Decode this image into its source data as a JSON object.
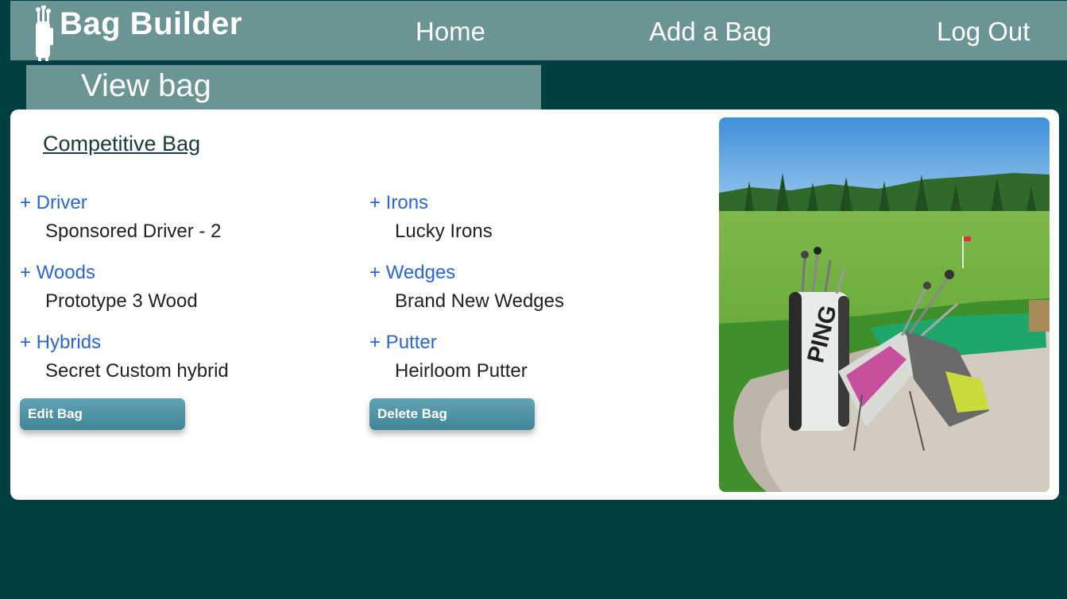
{
  "app": {
    "brand": "Bag Builder"
  },
  "nav": {
    "home": "Home",
    "add_bag": "Add a Bag",
    "log_out": "Log Out"
  },
  "page": {
    "title": "View bag"
  },
  "bag": {
    "name": "Competitive Bag",
    "clubs": [
      {
        "category": "+ Driver",
        "name": "Sponsored Driver - 2"
      },
      {
        "category": "+ Irons",
        "name": "Lucky Irons"
      },
      {
        "category": "+ Woods",
        "name": "Prototype 3 Wood"
      },
      {
        "category": "+ Wedges",
        "name": "Brand New Wedges"
      },
      {
        "category": "+ Hybrids",
        "name": "Secret Custom hybrid"
      },
      {
        "category": "+ Putter",
        "name": "Heirloom Putter"
      }
    ]
  },
  "actions": {
    "edit": "Edit Bag",
    "delete": "Delete Bag"
  },
  "photo": {
    "bag_logo_text": "PING"
  },
  "colors": {
    "background": "#004040",
    "nav": "#6b9494",
    "link": "#2a66d6",
    "button": "#4f95a6"
  },
  "icons": {
    "logo": "golf-bag-icon"
  }
}
